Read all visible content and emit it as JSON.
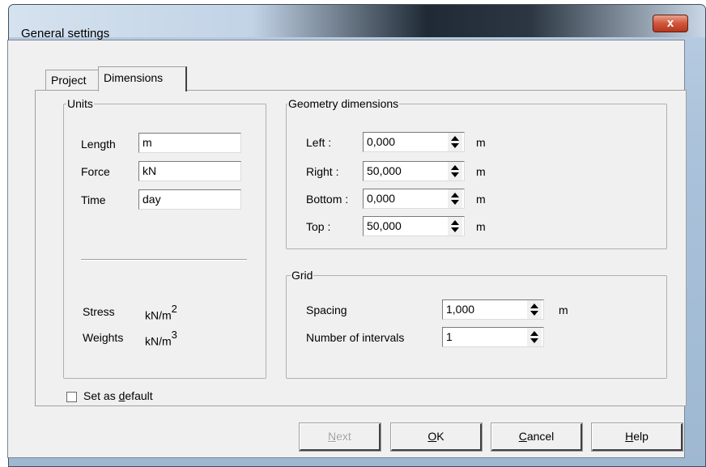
{
  "window": {
    "title": "General settings",
    "close_glyph": "x"
  },
  "tabs": [
    {
      "label": "Project",
      "active": false
    },
    {
      "label": "Dimensions",
      "active": true
    }
  ],
  "units": {
    "group_title": "Units",
    "length": {
      "label": "Length",
      "value": "m"
    },
    "force": {
      "label": "Force",
      "value": "kN"
    },
    "time": {
      "label": "Time",
      "value": "day"
    },
    "stress": {
      "label": "Stress",
      "unit_base": "kN/m",
      "unit_exp": "2"
    },
    "weights": {
      "label": "Weights",
      "unit_base": "kN/m",
      "unit_exp": "3"
    }
  },
  "geometry": {
    "group_title": "Geometry dimensions",
    "left": {
      "label": "Left :",
      "value": "0,000",
      "unit": "m"
    },
    "right": {
      "label": "Right :",
      "value": "50,000",
      "unit": "m"
    },
    "bottom": {
      "label": "Bottom :",
      "value": "0,000",
      "unit": "m"
    },
    "top": {
      "label": "Top :",
      "value": "50,000",
      "unit": "m"
    }
  },
  "grid": {
    "group_title": "Grid",
    "spacing": {
      "label": "Spacing",
      "value": "1,000",
      "unit": "m"
    },
    "intervals": {
      "label": "Number of intervals",
      "value": "1"
    }
  },
  "default_checkbox": {
    "pre": "Set as ",
    "accel": "d",
    "post": "efault",
    "checked": false
  },
  "buttons": {
    "next": {
      "accel": "N",
      "rest": "ext",
      "enabled": false
    },
    "ok": {
      "accel": "O",
      "rest": "K",
      "enabled": true
    },
    "cancel": {
      "accel": "C",
      "rest": "ancel",
      "enabled": true
    },
    "help": {
      "accel": "H",
      "rest": "elp",
      "enabled": true
    }
  },
  "colors": {
    "close_button": "#c8452b",
    "dialog_face": "#f0f0f0",
    "disabled_text": "#a0a0a0"
  }
}
